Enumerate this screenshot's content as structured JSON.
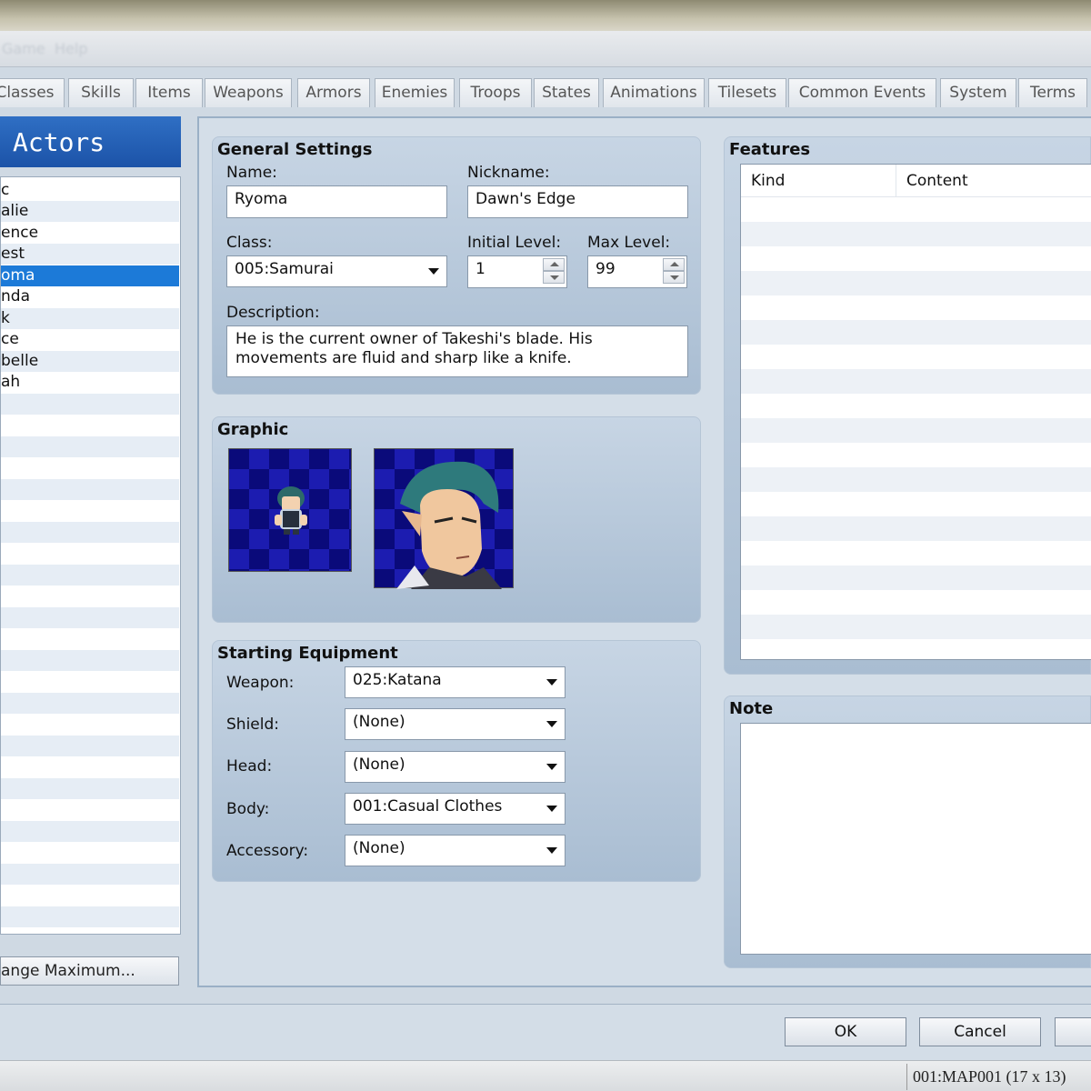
{
  "menu": {
    "items": [
      "Game",
      "Help"
    ]
  },
  "tabs": [
    "Classes",
    "Skills",
    "Items",
    "Weapons",
    "Armors",
    "Enemies",
    "Troops",
    "States",
    "Animations",
    "Tilesets",
    "Common Events",
    "System",
    "Terms"
  ],
  "actors": {
    "title": "Actors",
    "items": [
      "c",
      "alie",
      "ence",
      "est",
      "oma",
      "nda",
      "k",
      "ce",
      "belle",
      "ah"
    ],
    "selected_index": 4,
    "change_max_label": "ange Maximum..."
  },
  "general": {
    "title": "General Settings",
    "name_label": "Name:",
    "name_value": "Ryoma",
    "nickname_label": "Nickname:",
    "nickname_value": "Dawn's Edge",
    "class_label": "Class:",
    "class_value": "005:Samurai",
    "initial_level_label": "Initial Level:",
    "initial_level_value": "1",
    "max_level_label": "Max Level:",
    "max_level_value": "99",
    "description_label": "Description:",
    "description_line1": "He is the current owner of Takeshi's blade. His",
    "description_line2": "movements are fluid and sharp like a knife."
  },
  "graphic": {
    "title": "Graphic"
  },
  "equipment": {
    "title": "Starting Equipment",
    "weapon_label": "Weapon:",
    "weapon_value": "025:Katana",
    "shield_label": "Shield:",
    "shield_value": "(None)",
    "head_label": "Head:",
    "head_value": "(None)",
    "body_label": "Body:",
    "body_value": "001:Casual Clothes",
    "accessory_label": "Accessory:",
    "accessory_value": "(None)"
  },
  "features": {
    "title": "Features",
    "col_kind": "Kind",
    "col_content": "Content"
  },
  "note": {
    "title": "Note"
  },
  "buttons": {
    "ok": "OK",
    "cancel": "Cancel"
  },
  "status": {
    "map": "001:MAP001 (17 x 13)"
  }
}
